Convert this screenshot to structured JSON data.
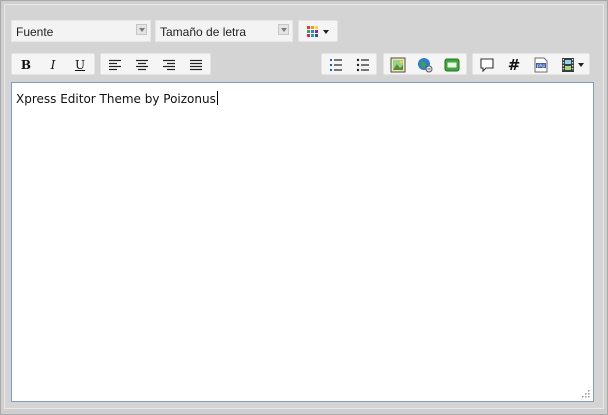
{
  "toolbar": {
    "font_select": {
      "label": "Fuente"
    },
    "size_select": {
      "label": "Tamaño de letra"
    },
    "color_picker": {
      "icon": "color-grid-icon"
    },
    "format": [
      {
        "name": "bold-button",
        "label": "B",
        "icon": "bold-icon"
      },
      {
        "name": "italic-button",
        "label": "I",
        "icon": "italic-icon"
      },
      {
        "name": "underline-button",
        "label": "U",
        "icon": "underline-icon"
      }
    ],
    "align": [
      {
        "name": "align-left-button",
        "icon": "align-left-icon"
      },
      {
        "name": "align-center-button",
        "icon": "align-center-icon"
      },
      {
        "name": "align-right-button",
        "icon": "align-right-icon"
      },
      {
        "name": "align-justify-button",
        "icon": "align-justify-icon"
      }
    ],
    "lists": [
      {
        "name": "ordered-list-button",
        "icon": "ordered-list-icon"
      },
      {
        "name": "unordered-list-button",
        "icon": "unordered-list-icon"
      }
    ],
    "insert": [
      {
        "name": "insert-image-button",
        "icon": "image-icon"
      },
      {
        "name": "insert-link-button",
        "icon": "globe-link-icon"
      },
      {
        "name": "insert-smiley-button",
        "icon": "smiley-icon"
      }
    ],
    "extra": [
      {
        "name": "quote-button",
        "icon": "speech-bubble-icon"
      },
      {
        "name": "hashtag-button",
        "label": "#",
        "icon": "hashtag-icon"
      },
      {
        "name": "php-code-button",
        "label": "php",
        "icon": "php-icon"
      },
      {
        "name": "media-button",
        "icon": "film-icon"
      }
    ]
  },
  "editor": {
    "content": "Xpress Editor Theme by Poizonus"
  },
  "colors": {
    "background": "#d4d4d4",
    "editor_border": "#7f9db9",
    "editor_background": "#ffffff"
  }
}
